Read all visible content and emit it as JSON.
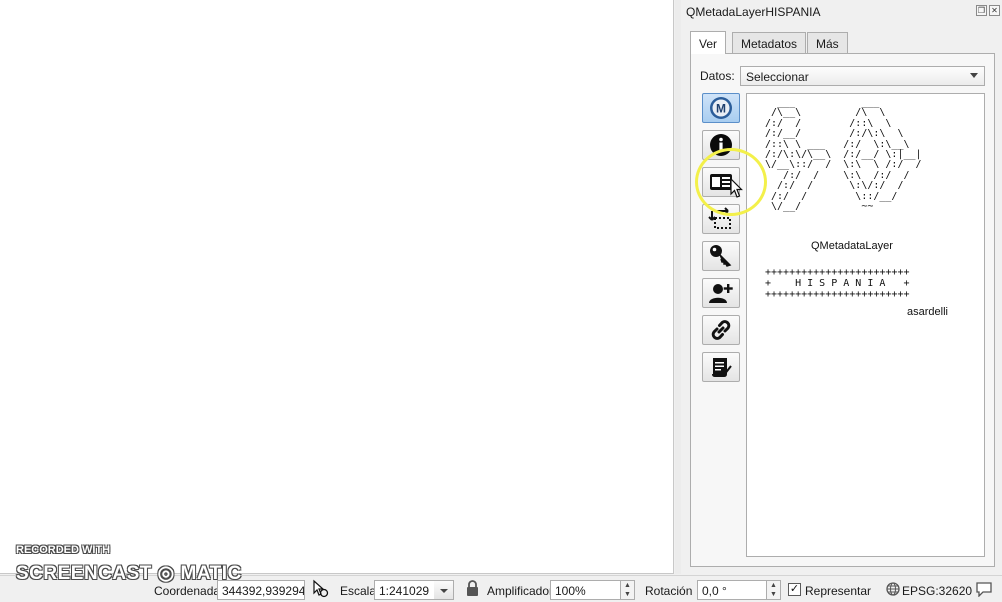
{
  "panel": {
    "title": "QMetadaLayerHISPANIA",
    "tabs": [
      "Ver",
      "Metadatos",
      "Más"
    ],
    "datos_label": "Datos:",
    "datos_value": "Seleccionar",
    "tools": [
      "metadata-logo-icon",
      "info-icon",
      "card-icon",
      "transfer-icon",
      "key-icon",
      "add-user-icon",
      "link-icon",
      "scroll-icon"
    ],
    "ascii_art": "  ___           ___\n /\\__\\         /\\  \\\n/:/  /        /::\\  \\\n/:/__/        /:/\\:\\  \\\n/::\\ \\ ___   /:/  \\:\\__\\\n/:/\\:\\/\\__\\  /:/__/ \\:|__|\n\\/__\\::/  /  \\:\\  \\ /:/  /\n   /:/  /    \\:\\  /:/  /\n  /:/  /      \\:\\/:/  /\n /:/  /        \\::/__/\n \\/__/          ~~",
    "ascii_name": "QMetadataLayer",
    "hispania_block": "++++++++++++++++++++++++\n+    H I S P A N I A   +\n++++++++++++++++++++++++",
    "author": "asardelli"
  },
  "statusbar": {
    "coord_label": "Coordenada",
    "coord_value": "344392,939294",
    "scale_label": "Escala",
    "scale_value": "1:241029",
    "magnifier_label": "Amplificador",
    "magnifier_value": "100%",
    "rotation_label": "Rotación",
    "rotation_value": "0,0 °",
    "render_label": "Representar",
    "crs_label": "EPSG:32620"
  },
  "watermark": {
    "recorded": "RECORDED WITH",
    "brand": "SCREENCAST ◎ MATIC"
  },
  "colors": {
    "accent": "#5b8fc9",
    "highlight_ring": "#f3f04a"
  }
}
